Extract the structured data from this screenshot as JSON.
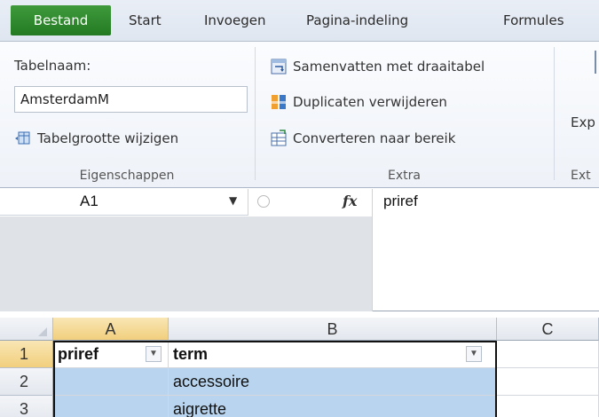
{
  "ribbon_tabs": {
    "file": "Bestand",
    "start": "Start",
    "insert": "Invoegen",
    "page_layout": "Pagina-indeling",
    "formulas": "Formules"
  },
  "properties_group": {
    "table_name_label": "Tabelnaam:",
    "table_name_value": "AmsterdamM",
    "resize_label": "Tabelgrootte wijzigen",
    "group_label": "Eigenschappen"
  },
  "extra_group": {
    "pivot_label": "Samenvatten met draaitabel",
    "remove_duplicates_label": "Duplicaten verwijderen",
    "convert_label": "Converteren naar bereik",
    "group_label": "Extra"
  },
  "external_group": {
    "export_label": "Exp",
    "group_label": "Ext"
  },
  "formula_bar": {
    "name_box": "A1",
    "fx": "fx",
    "content": "priref"
  },
  "grid": {
    "columns": [
      "A",
      "B",
      "C"
    ],
    "rows": [
      "1",
      "2",
      "3"
    ],
    "cells": {
      "a1": "priref",
      "b1": "term",
      "b2": "accessoire",
      "b3": "aigrette"
    }
  }
}
